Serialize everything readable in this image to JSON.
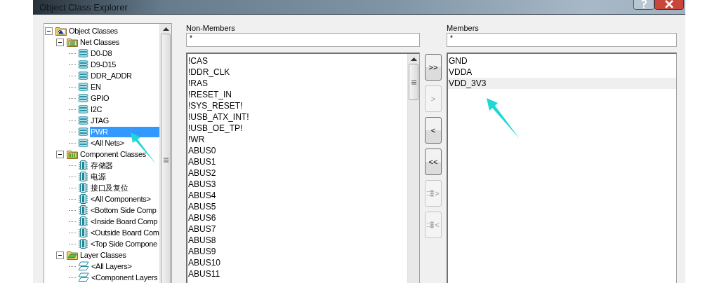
{
  "window": {
    "title": "Object Class Explorer"
  },
  "tree": [
    {
      "label": "Object Classes",
      "kind": "root",
      "expanded": true,
      "selected": false,
      "children": [
        {
          "label": "Net Classes",
          "kind": "net-folder",
          "expanded": true,
          "selected": false,
          "children": [
            {
              "label": "D0-D8",
              "kind": "net",
              "selected": false
            },
            {
              "label": "D9-D15",
              "kind": "net",
              "selected": false
            },
            {
              "label": "DDR_ADDR",
              "kind": "net",
              "selected": false
            },
            {
              "label": "EN",
              "kind": "net",
              "selected": false
            },
            {
              "label": "GPIO",
              "kind": "net",
              "selected": false
            },
            {
              "label": "I2C",
              "kind": "net",
              "selected": false
            },
            {
              "label": "JTAG",
              "kind": "net",
              "selected": false
            },
            {
              "label": "PWR",
              "kind": "net",
              "selected": true
            },
            {
              "label": "<All Nets>",
              "kind": "net",
              "selected": false
            }
          ]
        },
        {
          "label": "Component Classes",
          "kind": "component-folder",
          "expanded": true,
          "selected": false,
          "children": [
            {
              "label": "存储器",
              "kind": "component",
              "selected": false
            },
            {
              "label": "电源",
              "kind": "component",
              "selected": false
            },
            {
              "label": "接口及复位",
              "kind": "component",
              "selected": false
            },
            {
              "label": "<All Components>",
              "kind": "component",
              "selected": false
            },
            {
              "label": "<Bottom Side Comp",
              "kind": "component",
              "selected": false
            },
            {
              "label": "<Inside Board Comp",
              "kind": "component",
              "selected": false
            },
            {
              "label": "<Outside Board Com",
              "kind": "component",
              "selected": false
            },
            {
              "label": "<Top Side Compone",
              "kind": "component",
              "selected": false
            }
          ]
        },
        {
          "label": "Layer Classes",
          "kind": "layer-folder",
          "expanded": true,
          "selected": false,
          "children": [
            {
              "label": "<All Layers>",
              "kind": "layer",
              "selected": false
            },
            {
              "label": "<Component Layers",
              "kind": "layer",
              "selected": false
            }
          ]
        }
      ]
    }
  ],
  "non_members": {
    "label": "Non-Members",
    "filter": "*",
    "items": [
      {
        "label": "!CAS",
        "selected": false
      },
      {
        "label": "!DDR_CLK",
        "selected": false
      },
      {
        "label": "!RAS",
        "selected": false
      },
      {
        "label": "!RESET_IN",
        "selected": false
      },
      {
        "label": "!SYS_RESET!",
        "selected": false
      },
      {
        "label": "!USB_ATX_INT!",
        "selected": false
      },
      {
        "label": "!USB_OE_TP!",
        "selected": false
      },
      {
        "label": "!WR",
        "selected": false
      },
      {
        "label": "ABUS0",
        "selected": false
      },
      {
        "label": "ABUS1",
        "selected": false
      },
      {
        "label": "ABUS2",
        "selected": false
      },
      {
        "label": "ABUS3",
        "selected": false
      },
      {
        "label": "ABUS4",
        "selected": false
      },
      {
        "label": "ABUS5",
        "selected": false
      },
      {
        "label": "ABUS6",
        "selected": false
      },
      {
        "label": "ABUS7",
        "selected": false
      },
      {
        "label": "ABUS8",
        "selected": false
      },
      {
        "label": "ABUS9",
        "selected": false
      },
      {
        "label": "ABUS10",
        "selected": false
      },
      {
        "label": "ABUS11",
        "selected": false
      }
    ]
  },
  "buttons": [
    {
      "label": ">>",
      "kind": "text",
      "disabled": false
    },
    {
      "label": ">",
      "kind": "text",
      "disabled": true
    },
    {
      "label": "<",
      "kind": "text",
      "disabled": false
    },
    {
      "label": "<<",
      "kind": "text",
      "disabled": false
    },
    {
      "label": ">",
      "kind": "icon",
      "disabled": true
    },
    {
      "label": "<",
      "kind": "icon",
      "disabled": true
    }
  ],
  "members": {
    "label": "Members",
    "filter": "*",
    "items": [
      {
        "label": "GND",
        "selected": false
      },
      {
        "label": "VDDA",
        "selected": false
      },
      {
        "label": "VDD_3V3",
        "selected": true
      }
    ]
  }
}
